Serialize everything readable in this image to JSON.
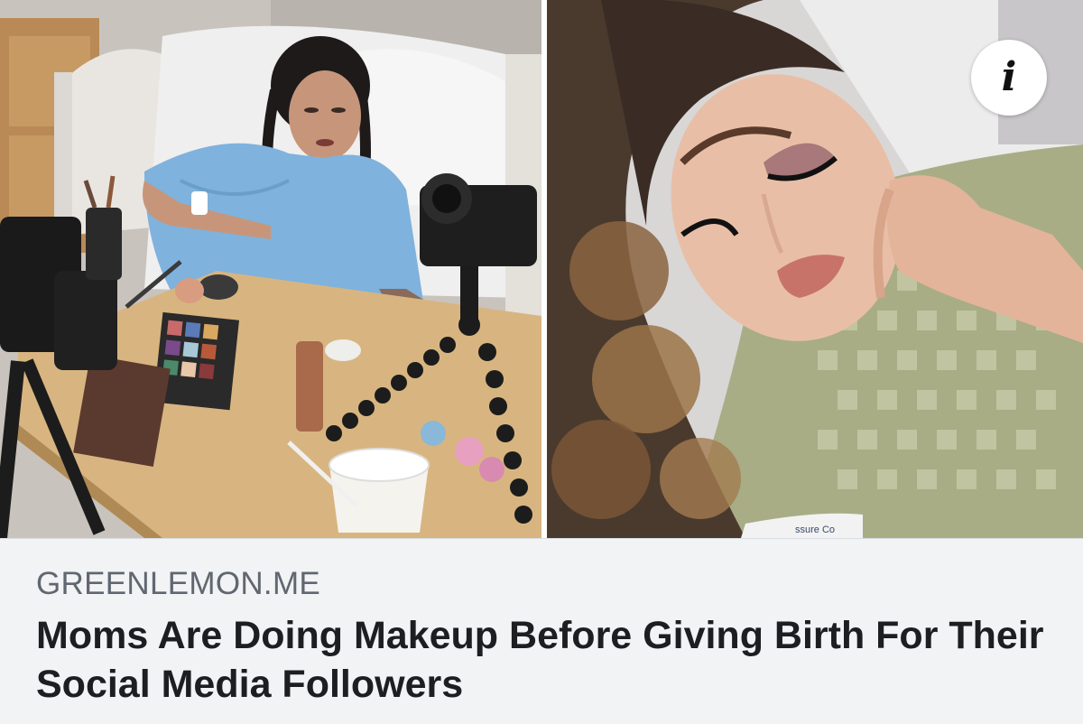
{
  "post": {
    "domain": "GREENLEMON.ME",
    "headline": "Moms Are Doing Makeup Before Giving Birth For Their Social Media Followers"
  },
  "media": {
    "info_icon": "info-icon",
    "info_glyph": "i",
    "left_photo": "photo of woman in hospital gown applying makeup at bed tray with camera on tripod",
    "right_photo": "close-up photo of woman with full makeup and curled hair in hospital bed",
    "gown_tag": "ssure Co"
  },
  "colors": {
    "domain_text": "#606770",
    "headline_text": "#1c1e21",
    "caption_bg": "#f2f3f5"
  }
}
